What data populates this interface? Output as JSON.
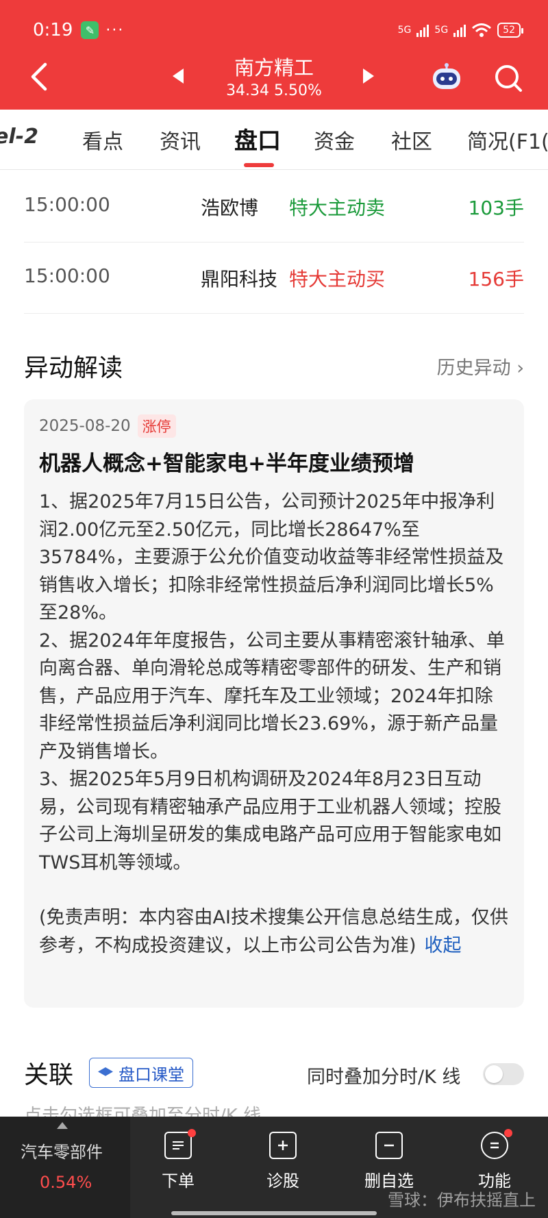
{
  "status_bar": {
    "time": "0:19",
    "dots": "···",
    "network1": "5G",
    "network2": "5G",
    "battery": "52"
  },
  "header": {
    "stock_name": "南方精工",
    "price_line": "34.34  5.50%",
    "brand_color": "#ee3b3b"
  },
  "tabs": [
    {
      "label": "el-2"
    },
    {
      "label": "看点"
    },
    {
      "label": "资讯"
    },
    {
      "label": "盘口"
    },
    {
      "label": "资金"
    },
    {
      "label": "社区"
    },
    {
      "label": "简况(F1("
    }
  ],
  "trades": [
    {
      "time": "15:00:00",
      "name": "浩欧博",
      "type": "特大主动卖",
      "volume": "103手"
    },
    {
      "time": "15:00:00",
      "name": "鼎阳科技",
      "type": "特大主动买",
      "volume": "156手"
    }
  ],
  "anomaly": {
    "title": "异动解读",
    "history_link": "历史异动 ›",
    "date": "2025-08-20",
    "badge": "涨停",
    "card_title": "机器人概念+智能家电+半年度业绩预增",
    "paragraphs": [
      "1、据2025年7月15日公告，公司预计2025年中报净利润2.00亿元至2.50亿元，同比增长28647%至35784%，主要源于公允价值变动收益等非经常性损益及销售收入增长；扣除非经常性损益后净利润同比增长5%至28%。",
      "2、据2024年年度报告，公司主要从事精密滚针轴承、单向离合器、单向滑轮总成等精密零部件的研发、生产和销售，产品应用于汽车、摩托车及工业领域；2024年扣除非经常性损益后净利润同比增长23.69%，源于新产品量产及销售增长。",
      "3、据2025年5月9日机构调研及2024年8月23日互动易，公司现有精密轴承产品应用于工业机器人领域；控股子公司上海圳呈研发的集成电路产品可应用于智能家电如TWS耳机等领域。"
    ],
    "disclaimer": "(免责声明：本内容由AI技术搜集公开信息总结生成，仅供参考，不构成投资建议，以上市公司公告为准)",
    "collapse": "收起"
  },
  "related": {
    "title": "关联",
    "course_button": "盘口课堂",
    "overlay_label": "同时叠加分时/K 线",
    "hint": "点击勾选框可叠加至分时/K 线"
  },
  "bottom_bar": {
    "sector_name": "汽车零部件",
    "sector_change": "0.54%",
    "items": [
      {
        "label": "下单",
        "icon": "order-icon"
      },
      {
        "label": "诊股",
        "icon": "diagnose-icon"
      },
      {
        "label": "删自选",
        "icon": "remove-watchlist-icon"
      },
      {
        "label": "功能",
        "icon": "function-menu-icon"
      }
    ],
    "watermark": "雪球：伊布扶摇直上"
  }
}
